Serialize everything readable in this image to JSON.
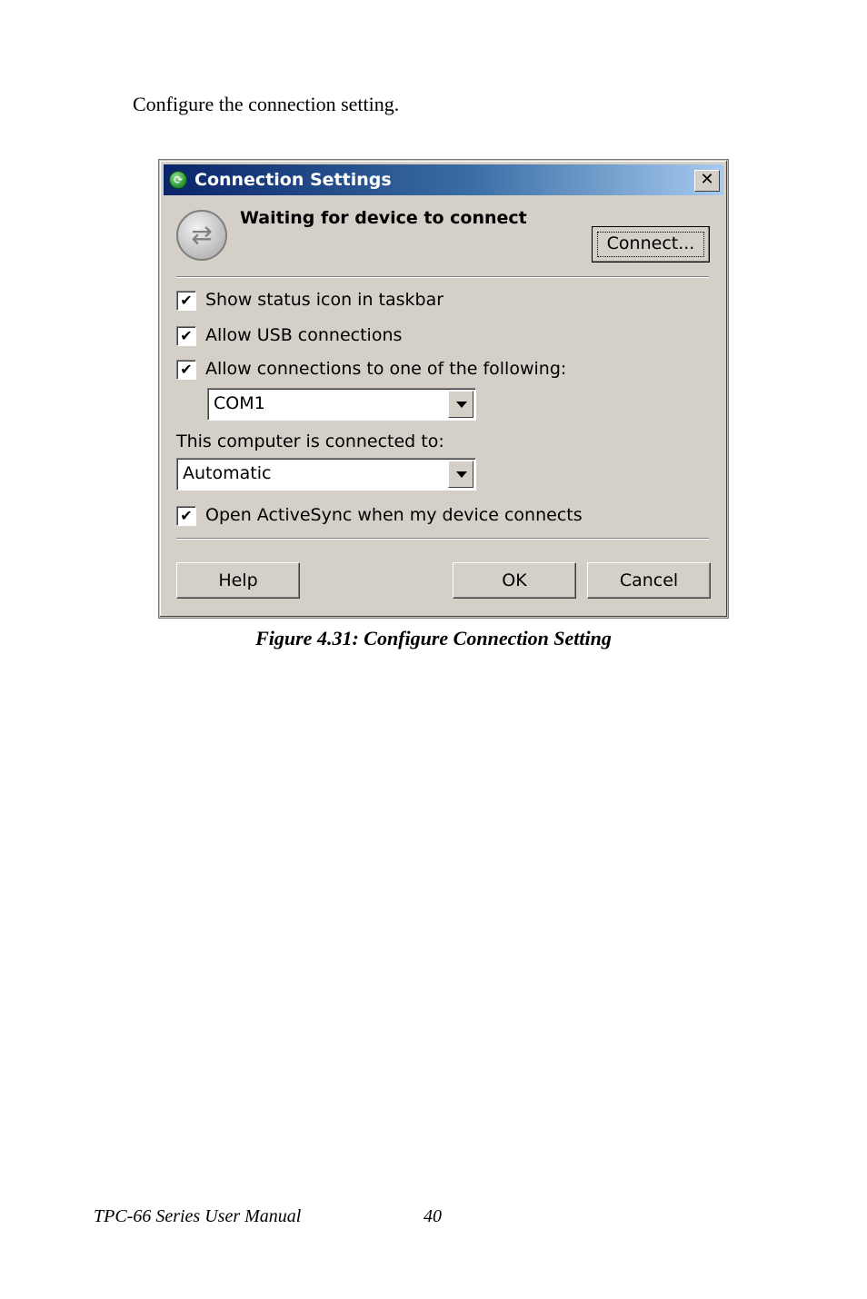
{
  "intro": "Configure the connection setting.",
  "dialog": {
    "title": "Connection Settings",
    "close_glyph": "✕",
    "status": "Waiting for device to connect",
    "connect_button": "Connect...",
    "checkboxes": [
      {
        "label": "Show status icon in taskbar",
        "checked": true
      },
      {
        "label": "Allow USB connections",
        "checked": true
      },
      {
        "label": "Allow connections to one of the following:",
        "checked": true
      }
    ],
    "port_select": "COM1",
    "connected_to_label": "This computer is connected to:",
    "connected_to_select": "Automatic",
    "open_activesync": {
      "label": "Open ActiveSync when my device connects",
      "checked": true
    },
    "help_button": "Help",
    "ok_button": "OK",
    "cancel_button": "Cancel",
    "check_glyph": "✔"
  },
  "caption": "Figure 4.31: Configure Connection Setting",
  "footer": {
    "title": "TPC-66 Series User Manual",
    "page": "40"
  }
}
